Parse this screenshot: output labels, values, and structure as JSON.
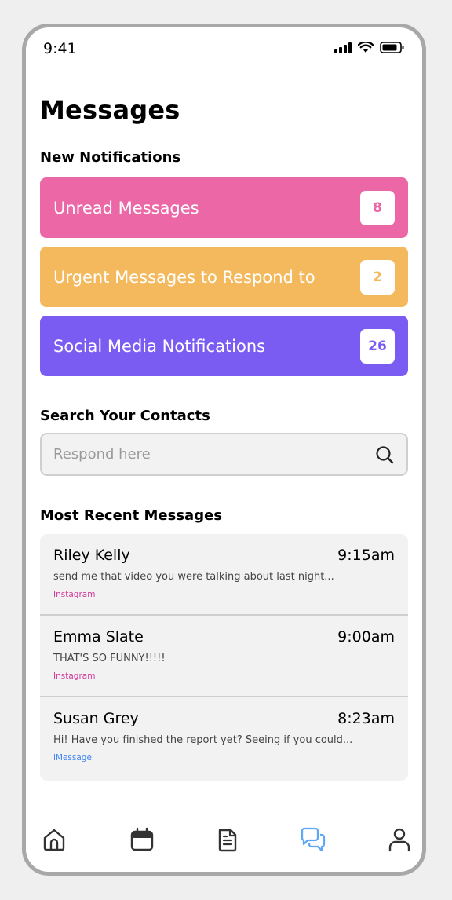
{
  "status_bar": {
    "time": "9:41"
  },
  "page": {
    "title": "Messages"
  },
  "notifications": {
    "label": "New Notifications",
    "items": [
      {
        "label": "Unread Messages",
        "count": "8",
        "color": "#ec67a6",
        "badge_color": "#ec67a6"
      },
      {
        "label": "Urgent Messages to Respond to",
        "count": "2",
        "color": "#f4b95c",
        "badge_color": "#f4b95c"
      },
      {
        "label": "Social Media Notifications",
        "count": "26",
        "color": "#7a5cf3",
        "badge_color": "#7a5cf3"
      }
    ]
  },
  "search": {
    "label": "Search Your Contacts",
    "placeholder": "Respond here"
  },
  "recent": {
    "label": "Most Recent Messages",
    "messages": [
      {
        "name": "Riley Kelly",
        "time": "9:15am",
        "preview": "send me that video you were talking about last night...",
        "source": "Instagram",
        "source_color": "#d4379b"
      },
      {
        "name": "Emma Slate",
        "time": "9:00am",
        "preview": "THAT'S SO FUNNY!!!!!",
        "source": "Instagram",
        "source_color": "#d4379b"
      },
      {
        "name": "Susan Grey",
        "time": "8:23am",
        "preview": "Hi! Have you finished the report yet? Seeing if you could...",
        "source": "iMessage",
        "source_color": "#3b82f6"
      }
    ]
  },
  "nav": {
    "items": [
      {
        "icon": "home-icon",
        "active": false
      },
      {
        "icon": "calendar-icon",
        "active": false
      },
      {
        "icon": "document-icon",
        "active": false
      },
      {
        "icon": "chat-icon",
        "active": true
      },
      {
        "icon": "profile-icon",
        "active": false
      }
    ],
    "active_color": "#5fa8f5",
    "inactive_color": "#333333"
  }
}
